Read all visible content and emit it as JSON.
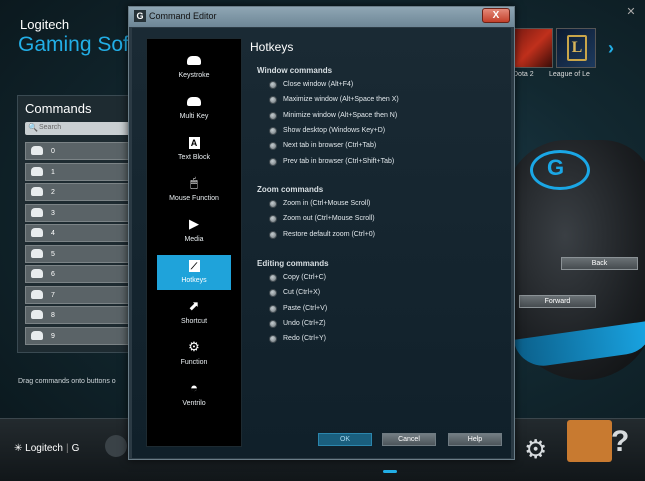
{
  "app": {
    "brand": "Logitech",
    "title": "Gaming Software",
    "games": [
      {
        "label": "Dota 2"
      },
      {
        "label": "League of Le"
      }
    ],
    "next_glyph": "›",
    "commands_heading": "Commands",
    "search_placeholder": "Search",
    "commands": [
      "0",
      "1",
      "2",
      "3",
      "4",
      "5",
      "6",
      "7",
      "8",
      "9"
    ],
    "drag_hint": "Drag commands onto buttons o",
    "mouse_buttons": {
      "back": "Back",
      "forward": "Forward"
    },
    "footer_brand": "Logitech",
    "footer_g": "G"
  },
  "dialog": {
    "title": "Command Editor",
    "close_glyph": "X",
    "functions": [
      {
        "label": "Keystroke"
      },
      {
        "label": "Multi Key"
      },
      {
        "label": "Text Block",
        "glyph": "A"
      },
      {
        "label": "Mouse Function"
      },
      {
        "label": "Media",
        "glyph": "▶"
      },
      {
        "label": "Hotkeys",
        "active": true
      },
      {
        "label": "Shortcut",
        "glyph": "⬈"
      },
      {
        "label": "Function",
        "glyph": "⚙"
      },
      {
        "label": "Ventrilo"
      }
    ],
    "content_title": "Hotkeys",
    "sections": [
      {
        "title": "Window commands",
        "options": [
          "Close window (Alt+F4)",
          "Maximize window (Alt+Space then X)",
          "Minimize window (Alt+Space then N)",
          "Show desktop (Windows Key+D)",
          "Next tab in browser (Ctrl+Tab)",
          "Prev tab in browser (Ctrl+Shift+Tab)"
        ]
      },
      {
        "title": "Zoom commands",
        "options": [
          "Zoom in (Ctrl+Mouse Scroll)",
          "Zoom out (Ctrl+Mouse Scroll)",
          "Restore default zoom (Ctrl+0)"
        ]
      },
      {
        "title": "Editing commands",
        "options": [
          "Copy (Ctrl+C)",
          "Cut (Ctrl+X)",
          "Paste (Ctrl+V)",
          "Undo (Ctrl+Z)",
          "Redo (Ctrl+Y)"
        ]
      }
    ],
    "buttons": {
      "ok": "OK",
      "cancel": "Cancel",
      "help": "Help"
    }
  },
  "colors": {
    "accent": "#1fa3da",
    "brand_blue": "#22aee6"
  }
}
